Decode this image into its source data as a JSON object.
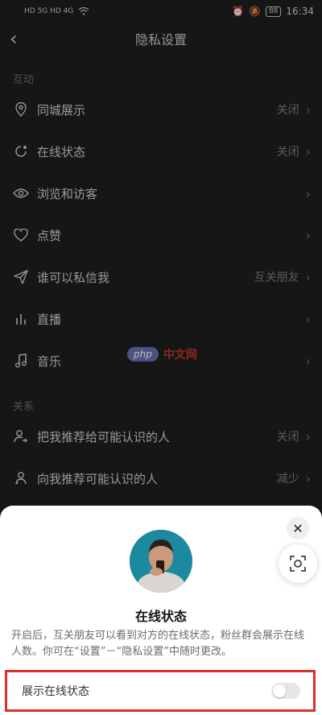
{
  "statusbar": {
    "left": "HD 5G HD 4G",
    "battery": "88",
    "time": "16:34"
  },
  "header": {
    "title": "隐私设置"
  },
  "sections": [
    {
      "title": "互动",
      "items": [
        {
          "label": "同城展示",
          "value": "关闭",
          "icon": "location-icon"
        },
        {
          "label": "在线状态",
          "value": "关闭",
          "icon": "online-status-icon"
        },
        {
          "label": "浏览和访客",
          "value": "",
          "icon": "eye-icon"
        },
        {
          "label": "点赞",
          "value": "",
          "icon": "heart-icon"
        },
        {
          "label": "谁可以私信我",
          "value": "互关朋友",
          "icon": "send-icon"
        },
        {
          "label": "直播",
          "value": "",
          "icon": "bars-icon"
        },
        {
          "label": "音乐",
          "value": "",
          "icon": "music-icon"
        }
      ]
    },
    {
      "title": "关系",
      "items": [
        {
          "label": "把我推荐给可能认识的人",
          "value": "关闭",
          "icon": "user-share-icon"
        },
        {
          "label": "向我推荐可能认识的人",
          "value": "减少",
          "icon": "user-recommend-icon"
        }
      ]
    }
  ],
  "watermark": {
    "logo": "php",
    "text": "中文网"
  },
  "sheet": {
    "title": "在线状态",
    "description": "开启后，互关朋友可以看到对方的在线状态，粉丝群会展示在线人数。你可在“设置”－“隐私设置”中随时更改。",
    "toggle_label": "展示在线状态",
    "toggle_on": false
  },
  "colors": {
    "highlight": "#d9312b",
    "page_bg": "#1f1f1f",
    "sheet_bg": "#ffffff"
  }
}
